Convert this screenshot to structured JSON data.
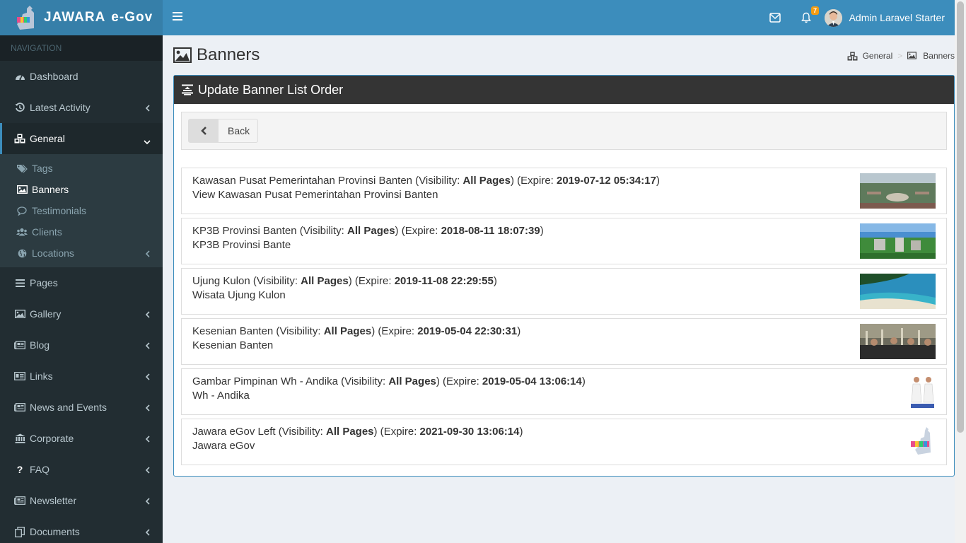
{
  "brand": {
    "name": "JAWARA",
    "suffix": "e-Gov"
  },
  "header": {
    "notification_count": "7",
    "user_name": "Admin Laravel Starter"
  },
  "sidebar": {
    "header": "NAVIGATION",
    "items": [
      {
        "label": "Dashboard",
        "icon": "dashboard-icon"
      },
      {
        "label": "Latest Activity",
        "icon": "history-icon"
      },
      {
        "label": "General",
        "icon": "cubes-icon"
      },
      {
        "label": "Pages",
        "icon": "bars-icon"
      },
      {
        "label": "Gallery",
        "icon": "image-icon"
      },
      {
        "label": "Blog",
        "icon": "newspaper-icon"
      },
      {
        "label": "Links",
        "icon": "id-card-icon"
      },
      {
        "label": "News and Events",
        "icon": "newspaper-icon"
      },
      {
        "label": "Corporate",
        "icon": "bank-icon"
      },
      {
        "label": "FAQ",
        "icon": "question-icon"
      },
      {
        "label": "Newsletter",
        "icon": "newspaper-icon"
      },
      {
        "label": "Documents",
        "icon": "copy-icon"
      }
    ],
    "general_sub": [
      {
        "label": "Tags",
        "icon": "tags-icon"
      },
      {
        "label": "Banners",
        "icon": "image-icon"
      },
      {
        "label": "Testimonials",
        "icon": "comment-icon"
      },
      {
        "label": "Clients",
        "icon": "users-icon"
      },
      {
        "label": "Locations",
        "icon": "globe-icon"
      }
    ]
  },
  "page": {
    "title": "Banners",
    "breadcrumb": [
      "General",
      "Banners"
    ]
  },
  "box": {
    "title": "Update Banner List Order",
    "back_label": "Back"
  },
  "banners": [
    {
      "name": "Kawasan Pusat Pemerintahan Provinsi Banten",
      "visibility": "All Pages",
      "expire": "2019-07-12 05:34:17",
      "caption": "View Kawasan Pusat Pemerintahan Provinsi Banten"
    },
    {
      "name": "KP3B Provinsi Banten",
      "visibility": "All Pages",
      "expire": "2018-08-11 18:07:39",
      "caption": "KP3B Provinsi Bante"
    },
    {
      "name": "Ujung Kulon",
      "visibility": "All Pages",
      "expire": "2019-11-08 22:29:55",
      "caption": "Wisata Ujung Kulon"
    },
    {
      "name": "Kesenian Banten",
      "visibility": "All Pages",
      "expire": "2019-05-04 22:30:31",
      "caption": "Kesenian Banten"
    },
    {
      "name": "Gambar Pimpinan Wh - Andika",
      "visibility": "All Pages",
      "expire": "2019-05-04 13:06:14",
      "caption": "Wh - Andika"
    },
    {
      "name": "Jawara eGov Left",
      "visibility": "All Pages",
      "expire": "2021-09-30 13:06:14",
      "caption": "Jawara eGov"
    }
  ],
  "labels": {
    "visibility": "Visibility:",
    "expire": "Expire:"
  },
  "colors": {
    "topbar": "#3c8dbc",
    "logo_bg": "#367fa9",
    "sidebar": "#222d32",
    "box_header": "#343434",
    "badge": "#f39c12"
  }
}
